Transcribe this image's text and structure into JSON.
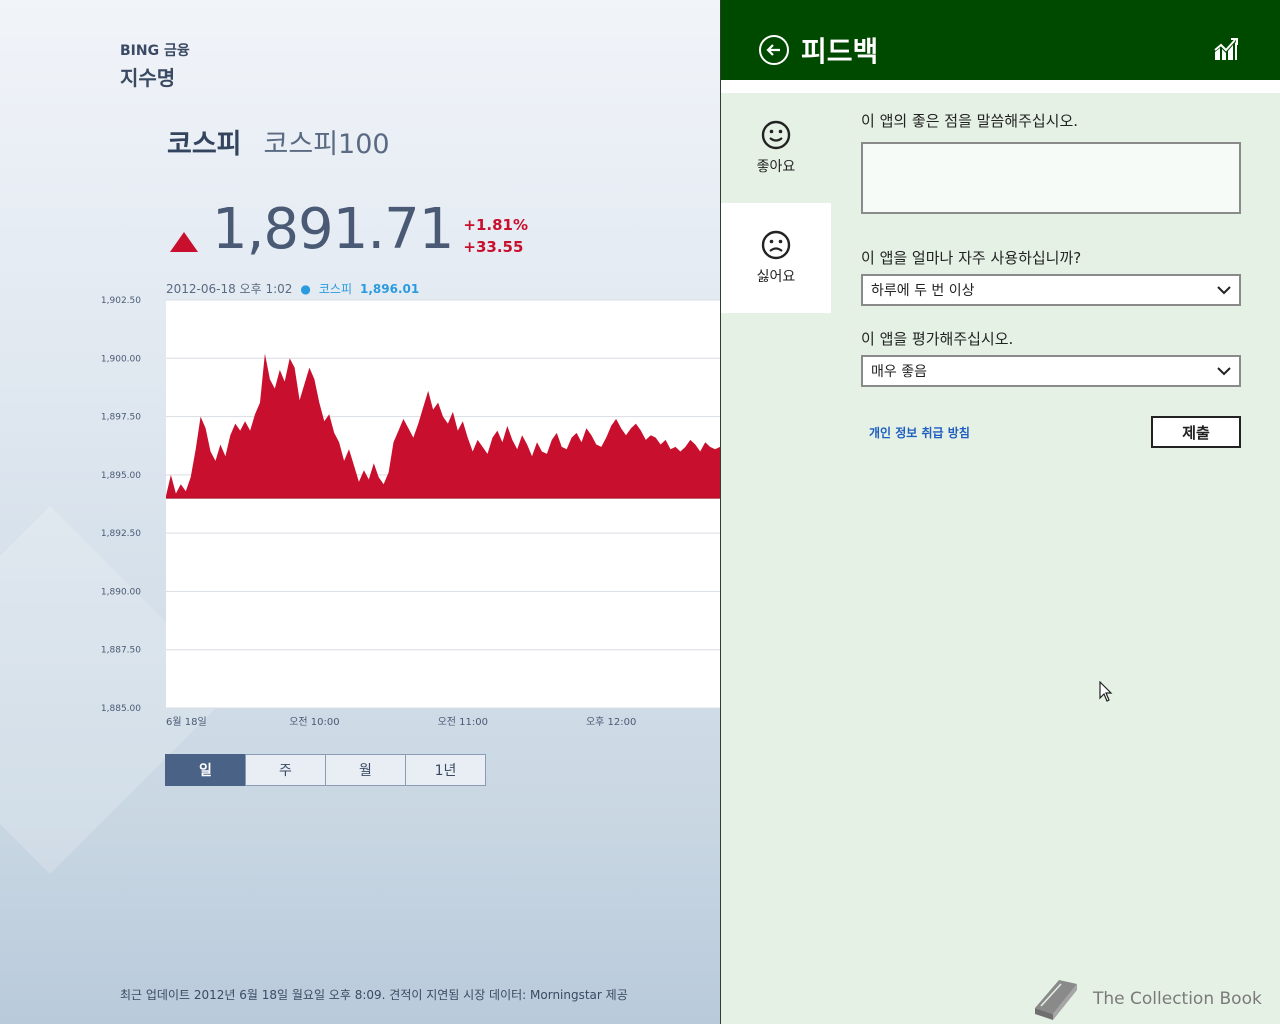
{
  "finance": {
    "brand": "BING 금융",
    "section_title": "지수명",
    "index_tabs": [
      {
        "label": "코스피",
        "active": true
      },
      {
        "label": "코스피100",
        "active": false
      }
    ],
    "price": "1,891.71",
    "change_percent": "+1.81%",
    "change_points": "+33.55",
    "chart_info": {
      "datetime": "2012-06-18 오후 1:02",
      "series": "코스피",
      "value": "1,896.01"
    },
    "range_tabs": [
      {
        "label": "일",
        "active": true
      },
      {
        "label": "주",
        "active": false
      },
      {
        "label": "월",
        "active": false
      },
      {
        "label": "1년",
        "active": false
      }
    ],
    "footer_note": "최근 업데이트 2012년 6월 18일 월요일 오후 8:09. 견적이 지연됨 시장 데이터: Morningstar 제공"
  },
  "chart_data": {
    "type": "area",
    "title": "",
    "xlabel": "",
    "ylabel": "",
    "ylim": [
      1885.0,
      1902.5
    ],
    "y_ticks": [
      "1,902.50",
      "1,900.00",
      "1,897.50",
      "1,895.00",
      "1,892.50",
      "1,890.00",
      "1,887.50",
      "1,885.00"
    ],
    "x_ticks": [
      {
        "label": "6월 18일",
        "t": 0
      },
      {
        "label": "오전 10:00",
        "t": 60
      },
      {
        "label": "오전 11:00",
        "t": 120
      },
      {
        "label": "오후 12:00",
        "t": 180
      }
    ],
    "baseline": 1894.0,
    "series": [
      {
        "fill": "#c8102e",
        "t": [
          0,
          2,
          4,
          6,
          8,
          10,
          12,
          14,
          16,
          18,
          20,
          22,
          24,
          26,
          28,
          30,
          32,
          34,
          36,
          38,
          40,
          42,
          44,
          46,
          48,
          50,
          52,
          54,
          56,
          58,
          60,
          62,
          64,
          66,
          68,
          70,
          72,
          74,
          76,
          78,
          80,
          82,
          84,
          86,
          88,
          90,
          92,
          94,
          96,
          98,
          100,
          102,
          104,
          106,
          108,
          110,
          112,
          114,
          116,
          118,
          120,
          122,
          124,
          126,
          128,
          130,
          132,
          134,
          136,
          138,
          140,
          142,
          144,
          146,
          148,
          150,
          152,
          154,
          156,
          158,
          160,
          162,
          164,
          166,
          168,
          170,
          172,
          174,
          176,
          178,
          180,
          182,
          184,
          186,
          188,
          190,
          192,
          194,
          196,
          198,
          200,
          202,
          204,
          206,
          208,
          210,
          212,
          214,
          216,
          218,
          220,
          222,
          224
        ],
        "values": [
          1894.1,
          1895.0,
          1894.2,
          1894.6,
          1894.3,
          1894.9,
          1896.1,
          1897.5,
          1897.0,
          1896.0,
          1895.6,
          1896.3,
          1895.8,
          1896.7,
          1897.2,
          1896.9,
          1897.3,
          1896.9,
          1897.6,
          1898.1,
          1900.2,
          1899.1,
          1898.7,
          1899.5,
          1899.0,
          1900.0,
          1899.6,
          1898.2,
          1898.9,
          1899.6,
          1899.1,
          1898.1,
          1897.3,
          1897.6,
          1896.8,
          1896.4,
          1895.6,
          1896.1,
          1895.4,
          1894.7,
          1895.2,
          1894.8,
          1895.5,
          1894.9,
          1894.6,
          1895.1,
          1896.4,
          1896.9,
          1897.4,
          1897.0,
          1896.6,
          1897.2,
          1897.9,
          1898.6,
          1897.8,
          1898.1,
          1897.5,
          1897.2,
          1897.7,
          1896.9,
          1897.3,
          1896.6,
          1896.0,
          1896.5,
          1896.2,
          1895.9,
          1896.6,
          1896.9,
          1896.4,
          1897.1,
          1896.5,
          1896.1,
          1896.7,
          1896.3,
          1895.8,
          1896.4,
          1896.0,
          1895.9,
          1896.5,
          1896.8,
          1896.2,
          1896.1,
          1896.6,
          1896.8,
          1896.4,
          1897.0,
          1896.7,
          1896.3,
          1896.2,
          1896.6,
          1897.1,
          1897.4,
          1897.0,
          1896.7,
          1897.0,
          1897.2,
          1896.9,
          1896.5,
          1896.7,
          1896.6,
          1896.3,
          1896.5,
          1896.1,
          1896.2,
          1896.0,
          1896.2,
          1896.5,
          1896.3,
          1896.0,
          1896.4,
          1896.2,
          1896.1,
          1896.2
        ]
      }
    ],
    "grid": true
  },
  "feedback": {
    "title": "피드백",
    "sentiments": [
      {
        "label": "좋아요",
        "icon": "smile-icon",
        "selected": false
      },
      {
        "label": "싫어요",
        "icon": "frown-icon",
        "selected": true
      }
    ],
    "q1": "이 앱의 좋은 점을 말씀해주십시오.",
    "q1_value": "",
    "q2": "이 앱을 얼마나 자주 사용하십니까?",
    "q2_value": "하루에 두 번 이상",
    "q3": "이 앱을 평가해주십시오.",
    "q3_value": "매우 좋음",
    "privacy_link": "개인 정보 취급 방침",
    "submit_label": "제출"
  },
  "watermark": {
    "text": "The Collection Book"
  },
  "colors": {
    "header_green": "#004a00",
    "pane_bg": "#e6f1e6",
    "chart_red": "#c8102e",
    "accent_blue": "#2b9be0",
    "link_blue": "#1f5fbf"
  }
}
